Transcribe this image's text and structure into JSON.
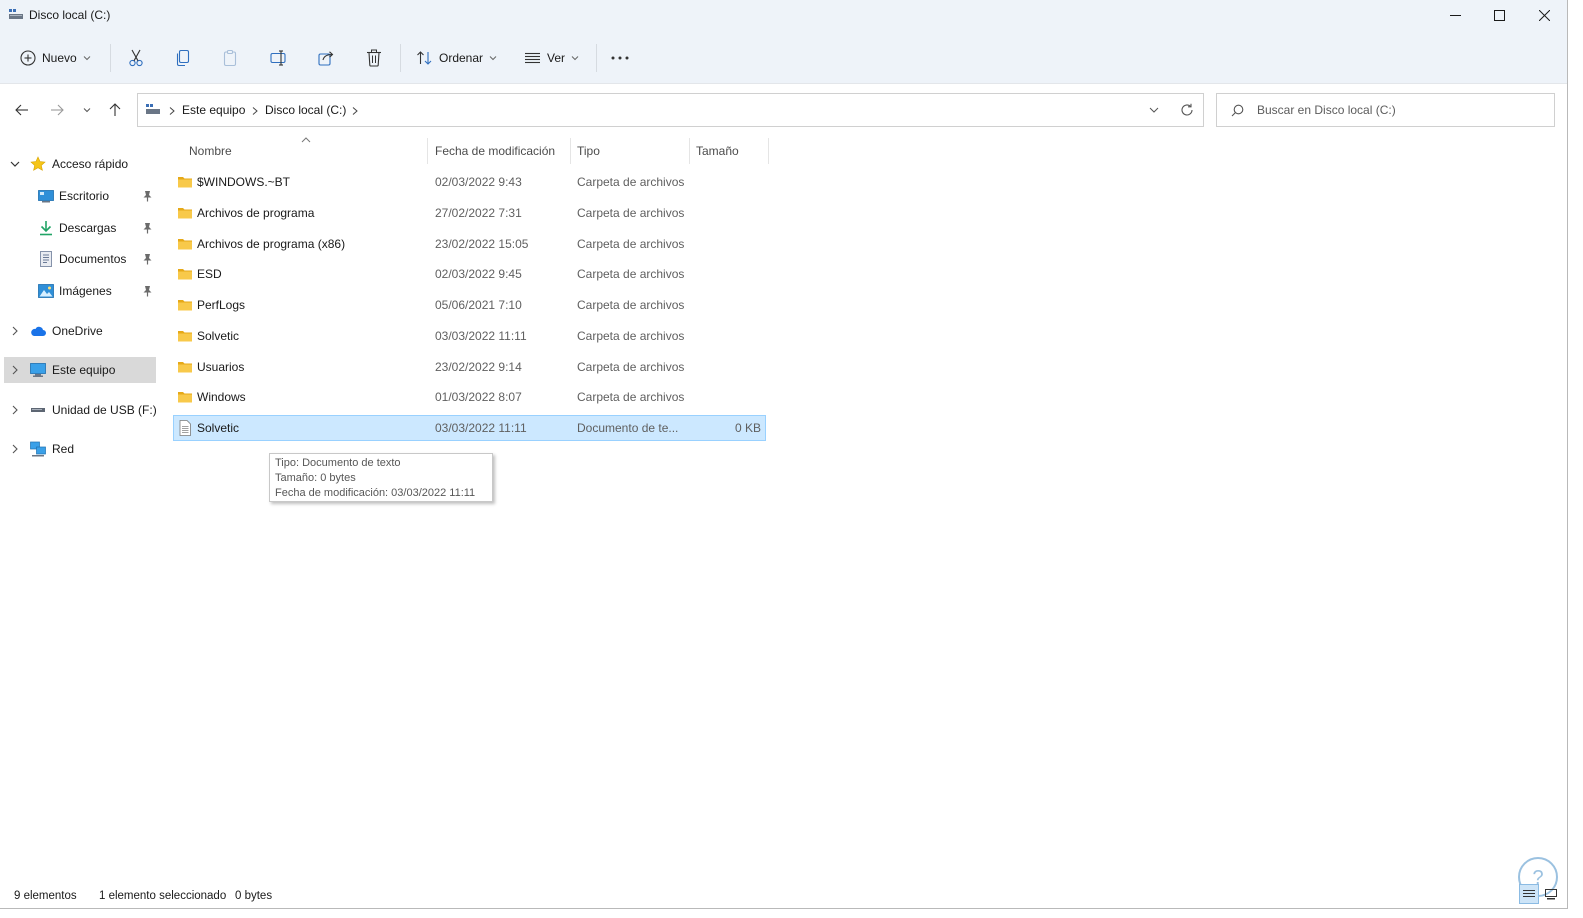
{
  "window": {
    "title": "Disco local (C:)"
  },
  "toolbar": {
    "new_label": "Nuevo",
    "sort_label": "Ordenar",
    "view_label": "Ver"
  },
  "address": {
    "crumbs": [
      "Este equipo",
      "Disco local (C:)"
    ]
  },
  "search": {
    "placeholder": "Buscar en Disco local (C:)"
  },
  "sidebar": {
    "items": [
      {
        "label": "Acceso rápido",
        "icon": "star-icon"
      },
      {
        "label": "Escritorio",
        "icon": "desktop-icon"
      },
      {
        "label": "Descargas",
        "icon": "download-icon"
      },
      {
        "label": "Documentos",
        "icon": "documents-icon"
      },
      {
        "label": "Imágenes",
        "icon": "pictures-icon"
      },
      {
        "label": "OneDrive",
        "icon": "cloud-icon"
      },
      {
        "label": "Este equipo",
        "icon": "computer-icon"
      },
      {
        "label": "Unidad de USB (F:)",
        "icon": "usb-drive-icon"
      },
      {
        "label": "Red",
        "icon": "network-icon"
      }
    ]
  },
  "columns": {
    "name": "Nombre",
    "date": "Fecha de modificación",
    "type": "Tipo",
    "size": "Tamaño"
  },
  "files": [
    {
      "name": "$WINDOWS.~BT",
      "date": "02/03/2022 9:43",
      "type": "Carpeta de archivos",
      "size": ""
    },
    {
      "name": "Archivos de programa",
      "date": "27/02/2022 7:31",
      "type": "Carpeta de archivos",
      "size": ""
    },
    {
      "name": "Archivos de programa (x86)",
      "date": "23/02/2022 15:05",
      "type": "Carpeta de archivos",
      "size": ""
    },
    {
      "name": "ESD",
      "date": "02/03/2022 9:45",
      "type": "Carpeta de archivos",
      "size": ""
    },
    {
      "name": "PerfLogs",
      "date": "05/06/2021 7:10",
      "type": "Carpeta de archivos",
      "size": ""
    },
    {
      "name": "Solvetic",
      "date": "03/03/2022 11:11",
      "type": "Carpeta de archivos",
      "size": ""
    },
    {
      "name": "Usuarios",
      "date": "23/02/2022 9:14",
      "type": "Carpeta de archivos",
      "size": ""
    },
    {
      "name": "Windows",
      "date": "01/03/2022 8:07",
      "type": "Carpeta de archivos",
      "size": ""
    },
    {
      "name": "Solvetic",
      "date": "03/03/2022 11:11",
      "type": "Documento de te...",
      "size": "0 KB"
    }
  ],
  "tooltip": {
    "line1": "Tipo: Documento de texto",
    "line2": "Tamaño: 0 bytes",
    "line3": "Fecha de modificación: 03/03/2022 11:11"
  },
  "status": {
    "count": "9 elementos",
    "selected": "1 elemento seleccionado",
    "bytes": "0 bytes"
  },
  "colors": {
    "toolbar_bg": "#eef3f9",
    "selection_bg": "#cce8ff",
    "folder_yellow": "#f8c94a",
    "sidebar_selected": "#d9d9d9"
  }
}
